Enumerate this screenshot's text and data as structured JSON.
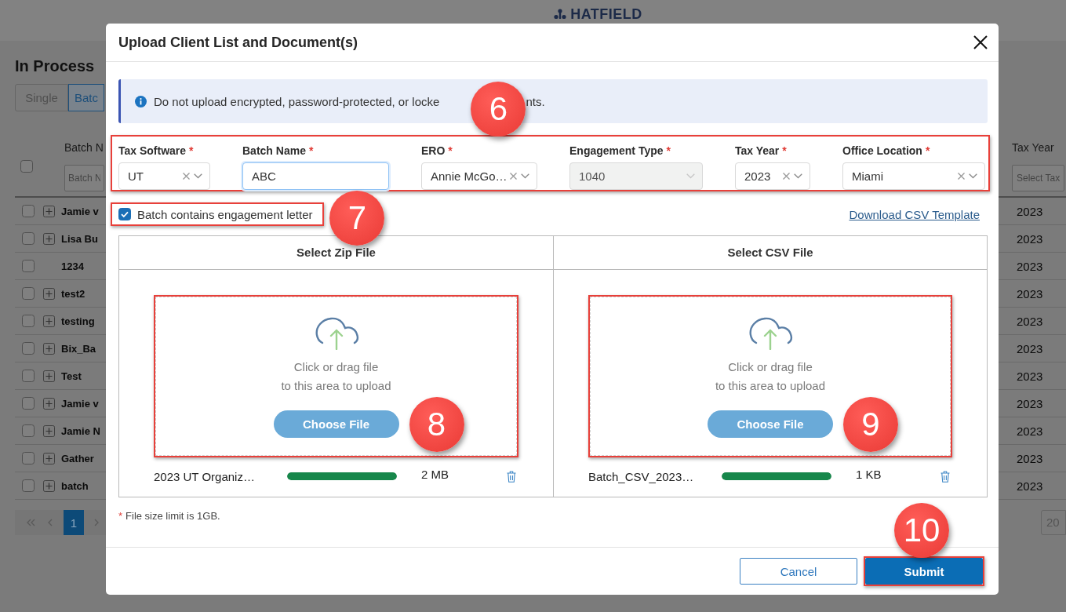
{
  "page": {
    "logo": "HATFIELD",
    "heading": "In Process",
    "view_tabs": [
      {
        "label": "Single",
        "selected": false
      },
      {
        "label": "Batc",
        "selected": true
      }
    ],
    "table": {
      "select_all_checked": false,
      "columns": [
        {
          "label": "Batch N",
          "filter_placeholder": "Batch N"
        },
        {
          "label": "Tax Year",
          "filter_placeholder": "Select Tax"
        }
      ],
      "rows": [
        {
          "checked": false,
          "expandable": true,
          "name": "Jamie v",
          "tax_year": "2023"
        },
        {
          "checked": false,
          "expandable": true,
          "name": "Lisa Bu",
          "tax_year": "2023"
        },
        {
          "checked": false,
          "expandable": false,
          "name": "1234",
          "tax_year": "2023"
        },
        {
          "checked": false,
          "expandable": true,
          "name": "test2",
          "tax_year": "2023"
        },
        {
          "checked": false,
          "expandable": true,
          "name": "testing",
          "tax_year": "2023"
        },
        {
          "checked": false,
          "expandable": true,
          "name": "Bix_Ba",
          "tax_year": "2023"
        },
        {
          "checked": false,
          "expandable": true,
          "name": "Test",
          "tax_year": "2023"
        },
        {
          "checked": false,
          "expandable": true,
          "name": "Jamie v",
          "tax_year": "2023"
        },
        {
          "checked": false,
          "expandable": true,
          "name": "Jamie N",
          "tax_year": "2023"
        },
        {
          "checked": false,
          "expandable": true,
          "name": "Gather",
          "tax_year": "2023"
        },
        {
          "checked": false,
          "expandable": true,
          "name": "batch",
          "tax_year": "2023"
        }
      ]
    },
    "pagination": {
      "pages": [
        {
          "label": "1",
          "selected": true
        }
      ],
      "page_size": "20"
    }
  },
  "modal": {
    "title": "Upload Client List and Document(s)",
    "notice": [
      "Do not upload encrypted, password-protected, or locke",
      "nts."
    ],
    "field_group": {
      "highlighted": true,
      "callout": "6",
      "fields": [
        {
          "kind": "select",
          "label": "Tax Software",
          "required_mark": "*",
          "value": "UT",
          "disabled": false,
          "focused": false
        },
        {
          "kind": "text",
          "label": "Batch Name",
          "required_mark": "*",
          "value": "ABC",
          "disabled": false,
          "focused": true
        },
        {
          "kind": "select",
          "label": "ERO",
          "required_mark": "*",
          "value": "Annie McGo…",
          "disabled": false,
          "focused": false
        },
        {
          "kind": "select",
          "label": "Engagement Type",
          "required_mark": "*",
          "value": "1040",
          "disabled": true,
          "focused": false
        },
        {
          "kind": "select",
          "label": "Tax Year",
          "required_mark": "*",
          "value": "2023",
          "disabled": false,
          "focused": false
        },
        {
          "kind": "select",
          "label": "Office Location",
          "required_mark": "*",
          "value": "Miami",
          "disabled": false,
          "focused": false
        }
      ]
    },
    "engagement_letter": {
      "label": "Batch contains engagement letter",
      "checked": true,
      "highlighted": true,
      "callout": "7"
    },
    "template_link": "Download CSV Template",
    "uploads": [
      {
        "heading": "Select Zip File",
        "hint": "Click or drag file\nto this area to upload",
        "button": "Choose File",
        "highlighted": true,
        "callout": "8",
        "file": {
          "name": "2023 UT Organiz…",
          "level": 1,
          "size": "2 MB"
        }
      },
      {
        "heading": "Select CSV File",
        "hint": "Click or drag file\nto this area to upload",
        "button": "Choose File",
        "highlighted": true,
        "callout": "9",
        "file": {
          "name": "Batch_CSV_2023…",
          "level": 1,
          "size": "1 KB"
        }
      }
    ],
    "note": {
      "mark": "*",
      "text": "File size limit is 1GB."
    },
    "actions": [
      {
        "kind": "secondary",
        "label": "Cancel",
        "highlighted": false
      },
      {
        "kind": "primary",
        "label": "Submit",
        "highlighted": true,
        "callout": "10"
      }
    ]
  }
}
